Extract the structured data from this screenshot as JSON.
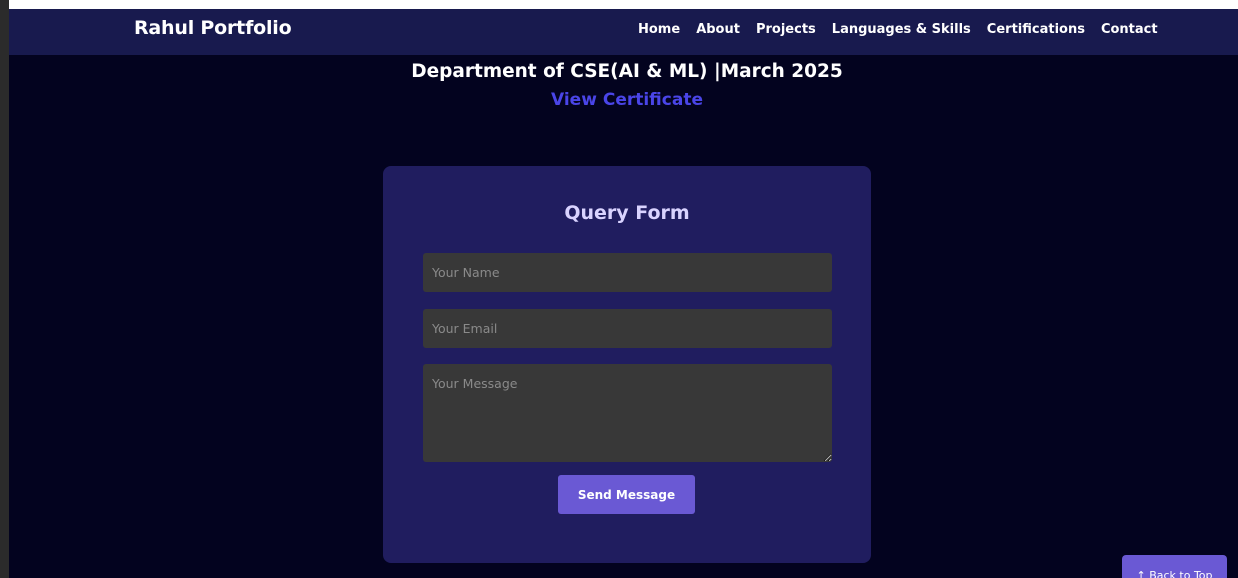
{
  "navbar": {
    "brand": "Rahul Portfolio",
    "links": [
      "Home",
      "About",
      "Projects",
      "Languages & Skills",
      "Certifications",
      "Contact"
    ]
  },
  "certification": {
    "title": "Department of CSE(AI & ML) |March 2025",
    "link_label": "View Certificate"
  },
  "query_form": {
    "title": "Query Form",
    "name_placeholder": "Your Name",
    "email_placeholder": "Your Email",
    "message_placeholder": "Your Message",
    "submit_label": "Send Message"
  },
  "back_to_top": {
    "label": "↑ Back to Top"
  },
  "colors": {
    "page_background": "#03031f",
    "navbar_background": "#181a4e",
    "card_background": "#201d5f",
    "input_background": "#383838",
    "accent": "#6a59d4",
    "link": "#4a45e8"
  }
}
